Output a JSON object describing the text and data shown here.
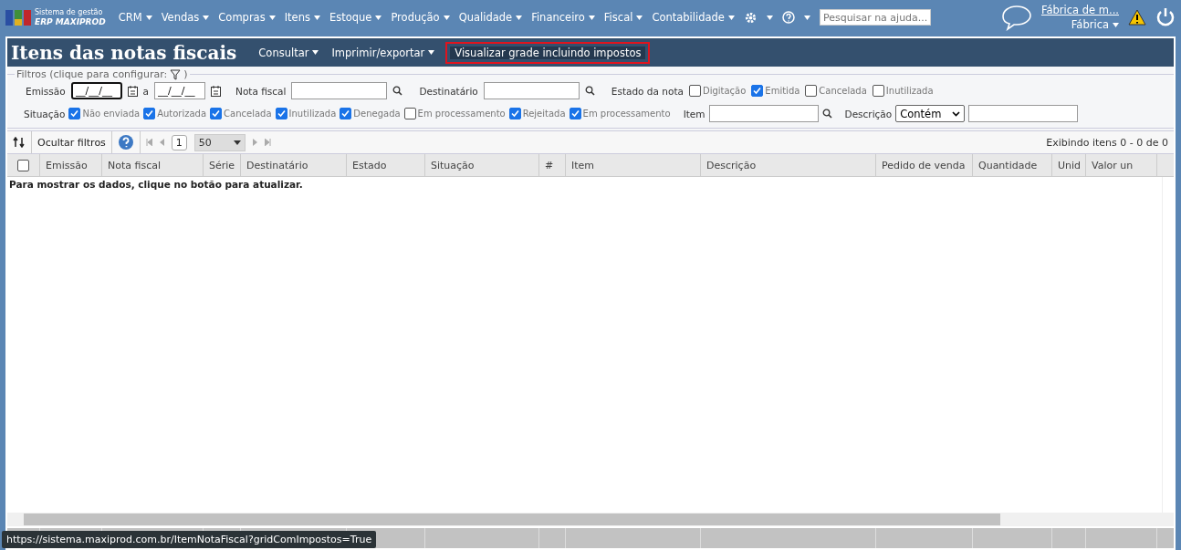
{
  "nav": {
    "logo": {
      "line1": "Sistema de gestão",
      "line2": "ERP MAXIPROD"
    },
    "menus": [
      "CRM",
      "Vendas",
      "Compras",
      "Itens",
      "Estoque",
      "Produção",
      "Qualidade",
      "Financeiro",
      "Fiscal",
      "Contabilidade"
    ],
    "search": {
      "placeholder": "Pesquisar na ajuda..."
    },
    "user": {
      "company": "Fábrica de m...",
      "unit": "Fábrica"
    }
  },
  "page": {
    "title": "Itens das notas fiscais",
    "actions": [
      {
        "label": "Consultar",
        "has_menu": true,
        "highlighted": false
      },
      {
        "label": "Imprimir/exportar",
        "has_menu": true,
        "highlighted": false
      },
      {
        "label": "Visualizar grade incluindo impostos",
        "has_menu": false,
        "highlighted": true
      }
    ]
  },
  "filters": {
    "legend": "Filtros (clique para configurar:",
    "legend_end": ")",
    "emissao": {
      "label": "Emissão",
      "from": "__/__/__",
      "separator": "a",
      "to": "__/__/__"
    },
    "nota_fiscal": {
      "label": "Nota fiscal"
    },
    "destinatario": {
      "label": "Destinatário"
    },
    "estado_da_nota": {
      "label": "Estado da nota",
      "options": [
        {
          "label": "Digitação",
          "checked": false
        },
        {
          "label": "Emitida",
          "checked": true
        },
        {
          "label": "Cancelada",
          "checked": false
        },
        {
          "label": "Inutilizada",
          "checked": false
        }
      ]
    },
    "situacao": {
      "label": "Situação",
      "options": [
        {
          "label": "Não enviada",
          "checked": true
        },
        {
          "label": "Autorizada",
          "checked": true
        },
        {
          "label": "Cancelada",
          "checked": true
        },
        {
          "label": "Inutilizada",
          "checked": true
        },
        {
          "label": "Denegada",
          "checked": true
        },
        {
          "label": "Em processamento",
          "checked": false
        },
        {
          "label": "Rejeitada",
          "checked": true
        },
        {
          "label": "Em processamento",
          "checked": true
        }
      ]
    },
    "item": {
      "label": "Item"
    },
    "descricao": {
      "label": "Descrição",
      "operator": "Contém"
    }
  },
  "toolbar": {
    "hide_filters": "Ocultar filtros",
    "page": "1",
    "page_size": "50",
    "summary": "Exibindo itens 0 - 0 de 0"
  },
  "grid": {
    "columns": [
      "Emissão",
      "Nota fiscal",
      "Série",
      "Destinatário",
      "Estado",
      "Situação",
      "#",
      "Item",
      "Descrição",
      "Pedido de venda",
      "Quantidade",
      "Unid",
      "Valor un"
    ],
    "select_all_checked": false,
    "empty_message": "Para mostrar os dados, clique no botão para atualizar."
  },
  "status_url": "https://sistema.maxiprod.com.br/ItemNotaFiscal?gridComImpostos=True"
}
